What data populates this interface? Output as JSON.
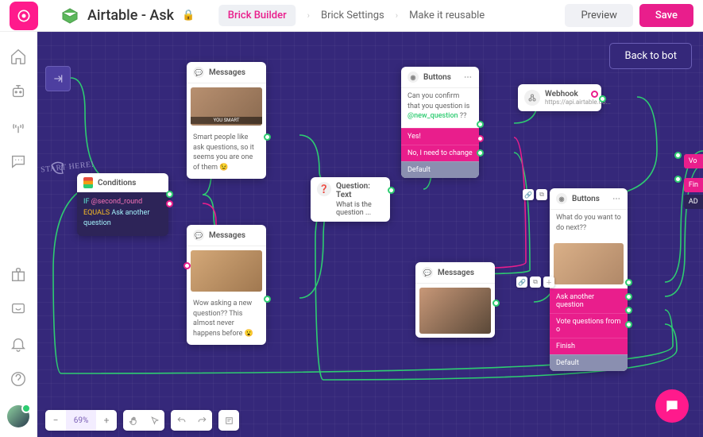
{
  "header": {
    "title": "Airtable - Ask",
    "tabs": {
      "builder": "Brick Builder",
      "settings": "Brick Settings",
      "reusable": "Make it reusable"
    },
    "preview": "Preview",
    "save": "Save"
  },
  "canvas": {
    "back": "Back to bot",
    "start_here": "START HERE!",
    "zoom": "69%"
  },
  "nodes": {
    "messages1": {
      "title": "Messages",
      "caption": "YOU SMART",
      "text": "Smart people like ask questions, so it seems you are one of them 😉"
    },
    "conditions": {
      "title": "Conditions",
      "kw": "IF",
      "var": "@second_round",
      "eq": "EQUALS",
      "val": "Ask another question"
    },
    "messages2": {
      "title": "Messages",
      "text": "Wow asking a new question?? This almost never happens before 😮"
    },
    "question": {
      "title": "Question: Text",
      "text": "What is the question ..."
    },
    "buttons1": {
      "title": "Buttons",
      "text_pre": "Can you confirm that you question is ",
      "var": "@new_question",
      "text_post": " ??",
      "opts": {
        "yes": "Yes!",
        "no": "No, I need to change",
        "default": "Default"
      }
    },
    "webhook": {
      "title": "Webhook",
      "url": "https://api.airtable.co..."
    },
    "messages3": {
      "title": "Messages"
    },
    "buttons2": {
      "title": "Buttons",
      "text": "What do you want to do next??",
      "opts": {
        "ask": "Ask another question",
        "vote": "Vote questions from o",
        "finish": "Finish",
        "default": "Default"
      }
    }
  },
  "overflow": {
    "vote": "Vo",
    "finish": "Fin",
    "add": "AD"
  }
}
